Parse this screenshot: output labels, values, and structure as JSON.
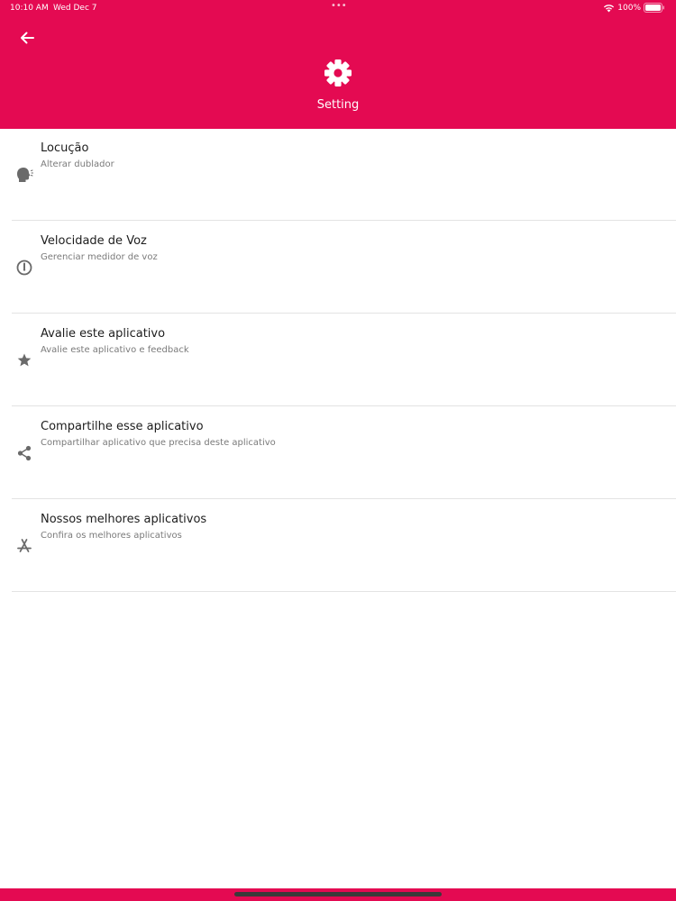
{
  "status_bar": {
    "time": "10:10 AM",
    "date": "Wed Dec 7",
    "dots": "•••",
    "battery": "100%"
  },
  "header": {
    "title": "Setting",
    "back_icon": "arrow-left-icon",
    "icon": "gear-icon",
    "background": "#e40a52"
  },
  "items": [
    {
      "title": "Locução",
      "subtitle": "Alterar dublador",
      "icon": "speaking-head-icon"
    },
    {
      "title": "Velocidade de Voz",
      "subtitle": "Gerenciar medidor de voz",
      "icon": "speedometer-icon"
    },
    {
      "title": "Avalie este aplicativo",
      "subtitle": "Avalie este aplicativo e feedback",
      "icon": "star-icon"
    },
    {
      "title": "Compartilhe esse aplicativo",
      "subtitle": "Compartilhar aplicativo que precisa deste aplicativo",
      "icon": "share-icon"
    },
    {
      "title": "Nossos melhores aplicativos",
      "subtitle": "Confira os melhores aplicativos",
      "icon": "app-store-icon"
    }
  ]
}
